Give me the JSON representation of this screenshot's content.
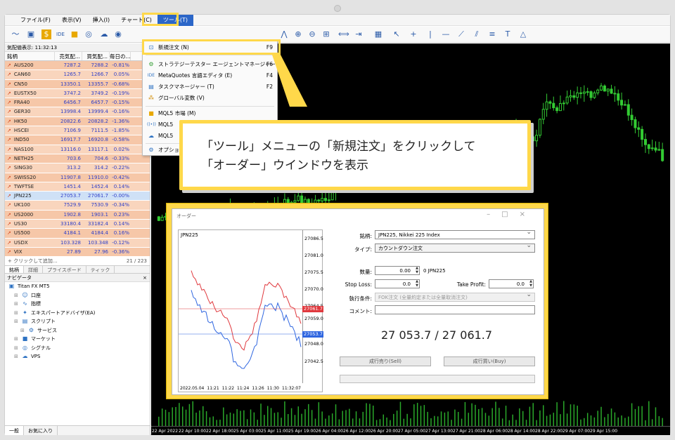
{
  "menu": {
    "items": [
      "ファイル(F)",
      "表示(V)",
      "挿入(I)",
      "チャート(C)",
      "ツール(T)"
    ],
    "active": "ツール(T)"
  },
  "tools_menu": {
    "items": [
      {
        "icon": "new-order-icon",
        "label": "新規注文 (N)",
        "key": "F9"
      },
      {
        "icon": "strategy-tester-icon",
        "label": "ストラテジーテスター エージェントマネージャー",
        "key": "F6"
      },
      {
        "icon": "metaeditor-icon",
        "label": "MetaQuotes 言語エディタ (E)",
        "key": "F4"
      },
      {
        "icon": "task-manager-icon",
        "label": "タスクマネージャー (T)",
        "key": "F2"
      },
      {
        "icon": "global-vars-icon",
        "label": "グローバル変数 (V)",
        "key": ""
      },
      {
        "icon": "market-icon",
        "label": "MQL5 市場 (M)",
        "key": ""
      },
      {
        "icon": "signals-icon",
        "label": "MQL5",
        "key": ""
      },
      {
        "icon": "vps-icon",
        "label": "MQL5",
        "key": ""
      },
      {
        "icon": "options-icon",
        "label": "オプション",
        "key": ""
      }
    ]
  },
  "market_watch": {
    "title": "気配値表示: 11:32:13",
    "columns": [
      "銘柄",
      "売気配...",
      "買気配...",
      "毎日の..."
    ],
    "rows": [
      {
        "symbol": "AUS200",
        "bid": "7287.2",
        "ask": "7288.2",
        "chg": "-0.81%"
      },
      {
        "symbol": "CAN60",
        "bid": "1265.7",
        "ask": "1266.7",
        "chg": "0.05%"
      },
      {
        "symbol": "CN50",
        "bid": "13350.1",
        "ask": "13355.7",
        "chg": "-0.68%"
      },
      {
        "symbol": "EUSTX50",
        "bid": "3747.2",
        "ask": "3749.2",
        "chg": "-0.19%"
      },
      {
        "symbol": "FRA40",
        "bid": "6456.7",
        "ask": "6457.7",
        "chg": "-0.15%"
      },
      {
        "symbol": "GER30",
        "bid": "13998.4",
        "ask": "13999.4",
        "chg": "-0.16%"
      },
      {
        "symbol": "HK50",
        "bid": "20822.6",
        "ask": "20828.2",
        "chg": "-1.36%"
      },
      {
        "symbol": "HSCEI",
        "bid": "7106.9",
        "ask": "7111.5",
        "chg": "-1.85%"
      },
      {
        "symbol": "IND50",
        "bid": "16917.7",
        "ask": "16920.8",
        "chg": "-0.58%"
      },
      {
        "symbol": "NAS100",
        "bid": "13116.0",
        "ask": "13117.1",
        "chg": "0.02%"
      },
      {
        "symbol": "NETH25",
        "bid": "703.6",
        "ask": "704.6",
        "chg": "-0.33%"
      },
      {
        "symbol": "SING30",
        "bid": "313.2",
        "ask": "314.2",
        "chg": "-0.22%"
      },
      {
        "symbol": "SWISS20",
        "bid": "11907.8",
        "ask": "11910.0",
        "chg": "-0.42%"
      },
      {
        "symbol": "TWFTSE",
        "bid": "1451.4",
        "ask": "1452.4",
        "chg": "0.14%"
      },
      {
        "symbol": "JPN225",
        "bid": "27053.7",
        "ask": "27061.7",
        "chg": "-0.00%"
      },
      {
        "symbol": "UK100",
        "bid": "7529.9",
        "ask": "7530.9",
        "chg": "-0.34%"
      },
      {
        "symbol": "US2000",
        "bid": "1902.8",
        "ask": "1903.1",
        "chg": "0.23%"
      },
      {
        "symbol": "US30",
        "bid": "33180.4",
        "ask": "33182.4",
        "chg": "0.14%"
      },
      {
        "symbol": "US500",
        "bid": "4184.1",
        "ask": "4184.4",
        "chg": "0.16%"
      },
      {
        "symbol": "USDX",
        "bid": "103.328",
        "ask": "103.348",
        "chg": "-0.12%"
      },
      {
        "symbol": "VIX",
        "bid": "27.89",
        "ask": "27.96",
        "chg": "-0.36%"
      }
    ],
    "add_label": "+ クリックして追加...",
    "count": "21 / 223",
    "tabs": [
      "銘柄",
      "詳細",
      "プライスボード",
      "ティック"
    ]
  },
  "navigator": {
    "title": "ナビゲータ",
    "items": [
      {
        "icon": "terminal-icon",
        "label": "Titan FX MT5",
        "indent": 0
      },
      {
        "icon": "accounts-icon",
        "label": "口座",
        "indent": 1
      },
      {
        "icon": "indicators-icon",
        "label": "指標",
        "indent": 1
      },
      {
        "icon": "expert-icon",
        "label": "エキスパートアドバイザ(EA)",
        "indent": 1
      },
      {
        "icon": "scripts-icon",
        "label": "スクリプト",
        "indent": 1
      },
      {
        "icon": "services-icon",
        "label": "サービス",
        "indent": 2
      },
      {
        "icon": "market-icon",
        "label": "マーケット",
        "indent": 1
      },
      {
        "icon": "signals-icon",
        "label": "シグナル",
        "indent": 1
      },
      {
        "icon": "vps-icon",
        "label": "VPS",
        "indent": 1
      }
    ],
    "tabs": [
      "一般",
      "お気に入り"
    ]
  },
  "chart": {
    "time_labels": [
      "22 Apr 2022",
      "22 Apr 10:00",
      "22 Apr 18:00",
      "25 Apr 03:00",
      "25 Apr 11:00",
      "25 Apr 19:00",
      "26 Apr 04:00",
      "26 Apr 12:00",
      "26 Apr 20:00",
      "27 Apr 05:00",
      "27 Apr 13:00",
      "27 Apr 21:00",
      "28 Apr 06:00",
      "28 Apr 14:00",
      "28 Apr 22:00",
      "29 Apr 07:00",
      "29 Apr 15:00"
    ]
  },
  "callout": {
    "line1": "「ツール」メニューの「新規注文」をクリックして",
    "line2": "「オーダー」ウインドウを表示"
  },
  "order": {
    "title": "オーダー",
    "symbol_label": "銘柄:",
    "symbol_value": "JPN225, Nikkei 225 Index",
    "type_label": "タイプ:",
    "type_value": "カウントダウン注文",
    "volume_label": "数量:",
    "volume_value": "0.00",
    "volume_unit": "0 JPN225",
    "sl_label": "Stop Loss:",
    "sl_value": "0.0",
    "tp_label": "Take Profit:",
    "tp_value": "0.0",
    "fill_label": "執行条件:",
    "fill_value": "FOK注文 (全量約定または全量取消注文)",
    "comment_label": "コメント:",
    "quote": "27 053.7 / 27 061.7",
    "sell_button": "成行売り(Sell)",
    "buy_button": "成行買い(Buy)",
    "mini_chart": {
      "symbol": "JPN225",
      "price_labels": [
        "27086.5",
        "27081.0",
        "27075.5",
        "27070.0",
        "27064.5",
        "27059.0",
        "27048.0",
        "27042.5"
      ],
      "ask_tag": "27061.7",
      "bid_tag": "27053.7",
      "time_labels": [
        "2022.05.04",
        "11:21",
        "11:22",
        "11:24",
        "11:26",
        "11:30",
        "11:32:07"
      ]
    }
  },
  "colors": {
    "highlight": "#ffd84a",
    "ask_line": "#e0393e",
    "bid_line": "#2f66e0",
    "quote_up": "#2f3fc9"
  }
}
